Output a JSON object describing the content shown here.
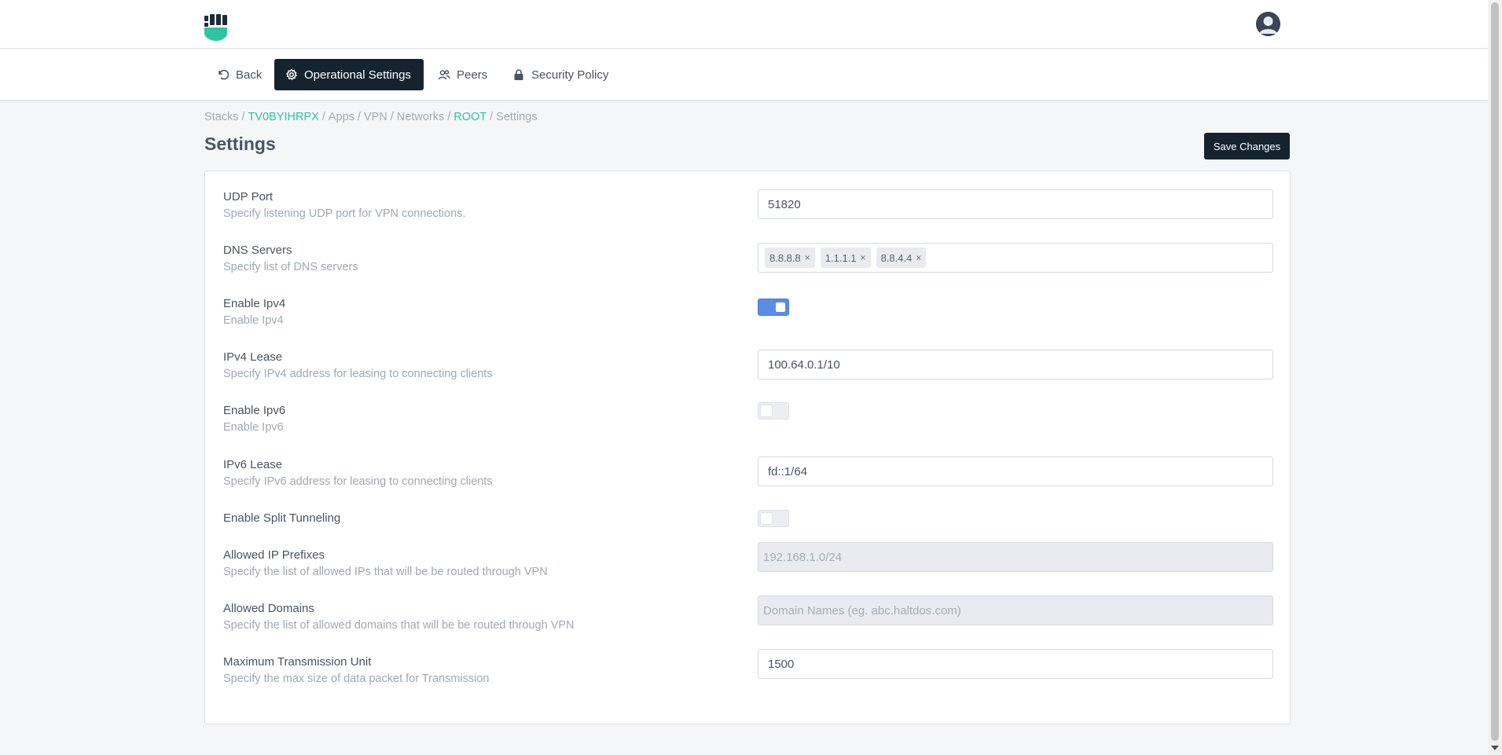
{
  "nav": {
    "back": "Back",
    "operational_settings": "Operational Settings",
    "peers": "Peers",
    "security_policy": "Security Policy"
  },
  "breadcrumb": [
    {
      "label": "Stacks",
      "link": false
    },
    {
      "label": "TV0BYIHRPX",
      "link": true
    },
    {
      "label": "Apps",
      "link": false
    },
    {
      "label": "VPN",
      "link": false
    },
    {
      "label": "Networks",
      "link": false
    },
    {
      "label": "ROOT",
      "link": true
    },
    {
      "label": "Settings",
      "link": false
    }
  ],
  "page": {
    "title": "Settings",
    "save_label": "Save Changes"
  },
  "settings": {
    "udp_port": {
      "label": "UDP Port",
      "desc": "Specify listening UDP port for VPN connections.",
      "value": "51820"
    },
    "dns_servers": {
      "label": "DNS Servers",
      "desc": "Specify list of DNS servers",
      "tags": [
        "8.8.8.8",
        "1.1.1.1",
        "8.8.4.4"
      ],
      "remove_glyph": "×"
    },
    "enable_ipv4": {
      "label": "Enable Ipv4",
      "desc": "Enable Ipv4",
      "enabled": true
    },
    "ipv4_lease": {
      "label": "IPv4 Lease",
      "desc": "Specify IPv4 address for leasing to connecting clients",
      "value": "100.64.0.1/10"
    },
    "enable_ipv6": {
      "label": "Enable Ipv6",
      "desc": "Enable Ipv6",
      "enabled": false
    },
    "ipv6_lease": {
      "label": "IPv6 Lease",
      "desc": "Specify IPv6 address for leasing to connecting clients",
      "value": "fd::1/64"
    },
    "split_tunneling": {
      "label": "Enable Split Tunneling",
      "enabled": false
    },
    "allowed_ip_prefixes": {
      "label": "Allowed IP Prefixes",
      "desc": "Specify the list of allowed IPs that will be be routed through VPN",
      "placeholder": "192.168.1.0/24"
    },
    "allowed_domains": {
      "label": "Allowed Domains",
      "desc": "Specify the list of allowed domains that will be be routed through VPN",
      "placeholder": "Domain Names (eg. abc.haltdos.com)"
    },
    "mtu": {
      "label": "Maximum Transmission Unit",
      "desc": "Specify the max size of data packet for Transmission",
      "value": "1500"
    }
  },
  "colors": {
    "accent": "#2fc3a1",
    "dark": "#15232f",
    "toggle_on": "#5a8de3"
  },
  "icons": {
    "logo": "haltdos-fist-logo",
    "avatar": "user-avatar-icon",
    "back": "undo-icon",
    "settings": "gear-icon",
    "peers": "users-icon",
    "security": "lock-icon"
  }
}
